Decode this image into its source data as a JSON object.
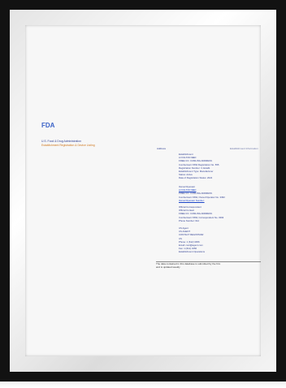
{
  "document": {
    "logo": "FDA",
    "header_line1": "U.S. Food & Drug Administration",
    "header_line2": "Establishment Registration & Device Listing",
    "left_label": "Address",
    "right_label": "Establishment Information",
    "sections": [
      {
        "lines": [
          "Establishment",
          "LOYALTON MED",
          "FREE CO. CUMLING ADDRESS",
          "Cumbertown NSW Registration No. 555",
          "Registration Number: 3. Establ.",
          "Establishment Type: Manufacturer",
          "Status: Active",
          "Date of Registration Status: 2022"
        ],
        "links": []
      },
      {
        "lines": [
          "Owner/Operator",
          "LOYALTON MED",
          "FREE CO. CUMLING ADDRESS",
          "Cumbertown NSW, Owner/Operator No. 3393",
          "Owner/Operator Number:"
        ],
        "links": [
          1,
          4
        ]
      },
      {
        "lines": [
          "Official Correspondent",
          "Official Contact",
          "FREE CO. CUMLING ADDRESS",
          "Cumbertown NSW, Correspondent No. 3393",
          "Phone Number: 612"
        ],
        "links": []
      },
      {
        "lines": [
          "US Agent",
          "US AGENT",
          "CONTACT REGISTRAR",
          "US",
          "Phone: 1 (612) 3456",
          "Email: cont@agent.com",
          "Fax: 1 (612) 3456",
          "Establishment Operations"
        ],
        "links": []
      }
    ],
    "footer_line1": "The data contained in this database is submitted by the firm",
    "footer_line2": "and is updated weekly"
  }
}
